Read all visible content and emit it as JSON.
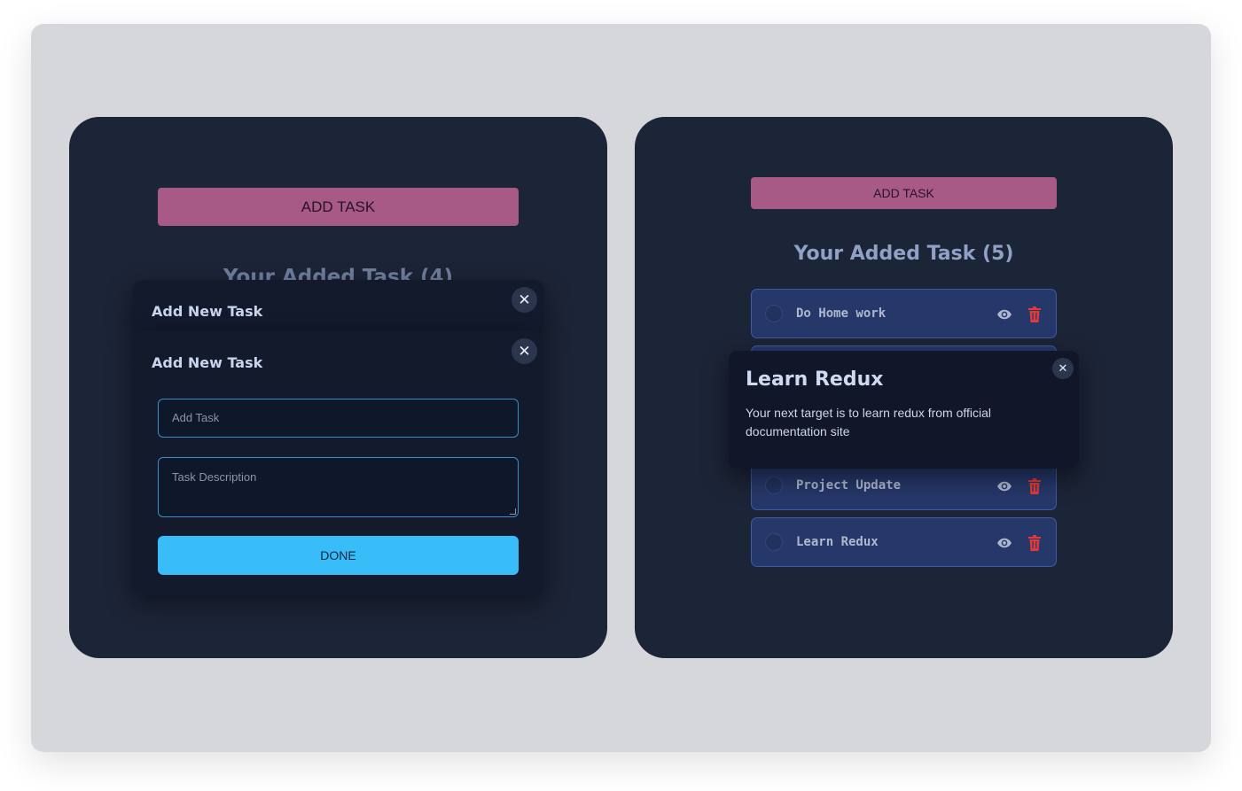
{
  "left_panel": {
    "add_button": "ADD TASK",
    "heading": "Your Added Task (4)",
    "modal_back": {
      "title": "Add New Task",
      "close": "✕"
    },
    "modal_front": {
      "title": "Add New Task",
      "close": "✕",
      "task_placeholder": "Add Task",
      "description_placeholder": "Task Description",
      "done_button": "DONE"
    }
  },
  "right_panel": {
    "add_button": "ADD TASK",
    "heading": "Your Added Task (5)",
    "tasks": [
      {
        "label": "Do Home work"
      },
      {
        "label": "Project Update"
      },
      {
        "label": "Learn Redux"
      }
    ],
    "popup": {
      "title": "Learn Redux",
      "body": "Your next target is to learn redux from official documentation site",
      "close": "✕"
    }
  },
  "colors": {
    "panel_bg": "#1c2437",
    "add_button_bg": "#a65a85",
    "done_button_bg": "#38bdf8",
    "task_bg": "#26386a",
    "trash": "#e03a3a",
    "eye": "#aeb8cf"
  },
  "icons": {
    "close": "close-icon",
    "view": "eye-icon",
    "delete": "trash-icon"
  }
}
